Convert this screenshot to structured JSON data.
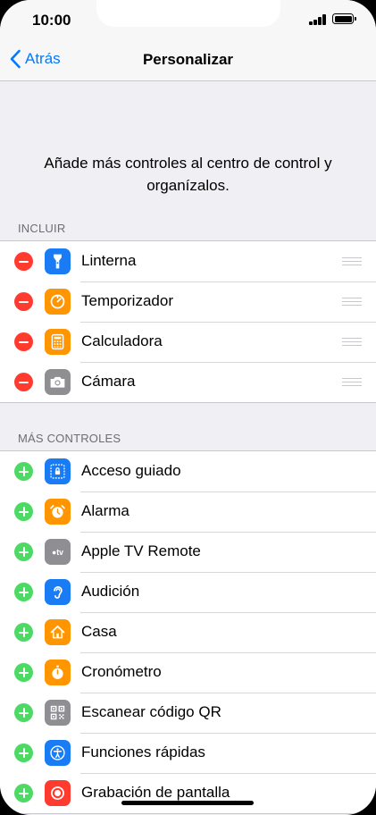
{
  "status_bar": {
    "time": "10:00"
  },
  "nav": {
    "back_label": "Atrás",
    "title": "Personalizar"
  },
  "description": "Añade más controles al centro de control y organízalos.",
  "include": {
    "header": "INCLUIR",
    "items": [
      {
        "label": "Linterna",
        "icon": "flashlight-icon",
        "color": "#1a7cf5"
      },
      {
        "label": "Temporizador",
        "icon": "timer-icon",
        "color": "#ff9500"
      },
      {
        "label": "Calculadora",
        "icon": "calculator-icon",
        "color": "#ff9500"
      },
      {
        "label": "Cámara",
        "icon": "camera-icon",
        "color": "#8e8e93"
      }
    ]
  },
  "more": {
    "header": "MÁS CONTROLES",
    "items": [
      {
        "label": "Acceso guiado",
        "icon": "guided-access-icon",
        "color": "#1a7cf5"
      },
      {
        "label": "Alarma",
        "icon": "alarm-icon",
        "color": "#ff9500"
      },
      {
        "label": "Apple TV Remote",
        "icon": "apple-tv-icon",
        "color": "#8e8e93"
      },
      {
        "label": "Audición",
        "icon": "hearing-icon",
        "color": "#1a7cf5"
      },
      {
        "label": "Casa",
        "icon": "home-icon",
        "color": "#ff9500"
      },
      {
        "label": "Cronómetro",
        "icon": "stopwatch-icon",
        "color": "#ff9500"
      },
      {
        "label": "Escanear código QR",
        "icon": "qr-code-icon",
        "color": "#8e8e93"
      },
      {
        "label": "Funciones rápidas",
        "icon": "accessibility-icon",
        "color": "#1a7cf5"
      },
      {
        "label": "Grabación de pantalla",
        "icon": "screen-recording-icon",
        "color": "#ff3b30"
      }
    ]
  }
}
